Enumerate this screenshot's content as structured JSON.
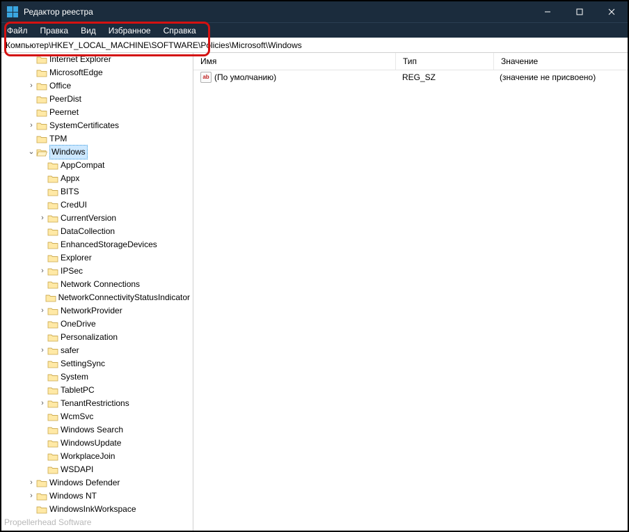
{
  "titlebar": {
    "title": "Редактор реестра"
  },
  "menu": {
    "items": [
      "Файл",
      "Правка",
      "Вид",
      "Избранное",
      "Справка"
    ]
  },
  "address": {
    "path": "Компьютер\\HKEY_LOCAL_MACHINE\\SOFTWARE\\Policies\\Microsoft\\Windows"
  },
  "tree": {
    "topIndent": 2,
    "items": [
      {
        "indent": 2,
        "exp": "",
        "label": "Internet Explorer"
      },
      {
        "indent": 2,
        "exp": "",
        "label": "MicrosoftEdge"
      },
      {
        "indent": 2,
        "exp": ">",
        "label": "Office"
      },
      {
        "indent": 2,
        "exp": "",
        "label": "PeerDist"
      },
      {
        "indent": 2,
        "exp": "",
        "label": "Peernet"
      },
      {
        "indent": 2,
        "exp": ">",
        "label": "SystemCertificates"
      },
      {
        "indent": 2,
        "exp": "",
        "label": "TPM"
      },
      {
        "indent": 2,
        "exp": "v",
        "label": "Windows",
        "selected": true,
        "open": true
      },
      {
        "indent": 3,
        "exp": "",
        "label": "AppCompat"
      },
      {
        "indent": 3,
        "exp": "",
        "label": "Appx"
      },
      {
        "indent": 3,
        "exp": "",
        "label": "BITS"
      },
      {
        "indent": 3,
        "exp": "",
        "label": "CredUI"
      },
      {
        "indent": 3,
        "exp": ">",
        "label": "CurrentVersion"
      },
      {
        "indent": 3,
        "exp": "",
        "label": "DataCollection"
      },
      {
        "indent": 3,
        "exp": "",
        "label": "EnhancedStorageDevices"
      },
      {
        "indent": 3,
        "exp": "",
        "label": "Explorer"
      },
      {
        "indent": 3,
        "exp": ">",
        "label": "IPSec"
      },
      {
        "indent": 3,
        "exp": "",
        "label": "Network Connections"
      },
      {
        "indent": 3,
        "exp": "",
        "label": "NetworkConnectivityStatusIndicator"
      },
      {
        "indent": 3,
        "exp": ">",
        "label": "NetworkProvider"
      },
      {
        "indent": 3,
        "exp": "",
        "label": "OneDrive"
      },
      {
        "indent": 3,
        "exp": "",
        "label": "Personalization"
      },
      {
        "indent": 3,
        "exp": ">",
        "label": "safer"
      },
      {
        "indent": 3,
        "exp": "",
        "label": "SettingSync"
      },
      {
        "indent": 3,
        "exp": "",
        "label": "System"
      },
      {
        "indent": 3,
        "exp": "",
        "label": "TabletPC"
      },
      {
        "indent": 3,
        "exp": ">",
        "label": "TenantRestrictions"
      },
      {
        "indent": 3,
        "exp": "",
        "label": "WcmSvc"
      },
      {
        "indent": 3,
        "exp": "",
        "label": "Windows Search"
      },
      {
        "indent": 3,
        "exp": "",
        "label": "WindowsUpdate"
      },
      {
        "indent": 3,
        "exp": "",
        "label": "WorkplaceJoin"
      },
      {
        "indent": 3,
        "exp": "",
        "label": "WSDAPI"
      },
      {
        "indent": 2,
        "exp": ">",
        "label": "Windows Defender"
      },
      {
        "indent": 2,
        "exp": ">",
        "label": "Windows NT"
      },
      {
        "indent": 2,
        "exp": "",
        "label": "WindowsInkWorkspace"
      }
    ],
    "cutoff": "Propellerhead Software"
  },
  "columns": {
    "name": "Имя",
    "type": "Тип",
    "value": "Значение"
  },
  "rows": [
    {
      "name": "(По умолчанию)",
      "type": "REG_SZ",
      "value": "(значение не присвоено)"
    }
  ]
}
